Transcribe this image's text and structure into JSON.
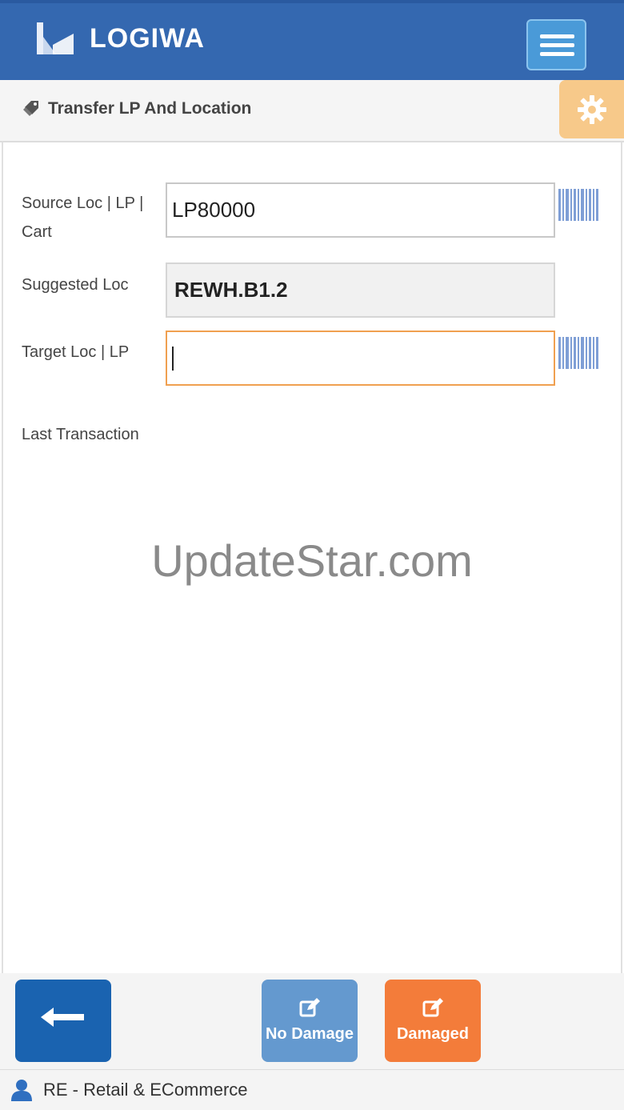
{
  "header": {
    "brand": "LOGIWA",
    "menu_icon": "hamburger-menu-icon"
  },
  "page": {
    "title": "Transfer LP And Location",
    "title_icon": "tags-icon",
    "settings_icon": "gear-icon"
  },
  "form": {
    "source_label_line1": "Source Loc | LP |",
    "source_label_line2": "Cart",
    "source_value": "LP80000",
    "suggested_label": "Suggested Loc",
    "suggested_value": "REWH.B1.2",
    "target_label": "Target Loc | LP",
    "target_value": "",
    "last_transaction_label": "Last Transaction"
  },
  "watermark": "UpdateStar.com",
  "actions": {
    "back_icon": "arrow-left-icon",
    "no_damage_label": "No Damage",
    "damaged_label": "Damaged"
  },
  "status": {
    "user_icon": "user-icon",
    "company": "RE - Retail & ECommerce"
  },
  "colors": {
    "header_bg": "#3468b0",
    "settings_bg": "#f7c98a",
    "back_btn": "#1a63b0",
    "no_damage_btn": "#6499cf",
    "damaged_btn": "#f37c3a",
    "active_border": "#f0a050"
  }
}
